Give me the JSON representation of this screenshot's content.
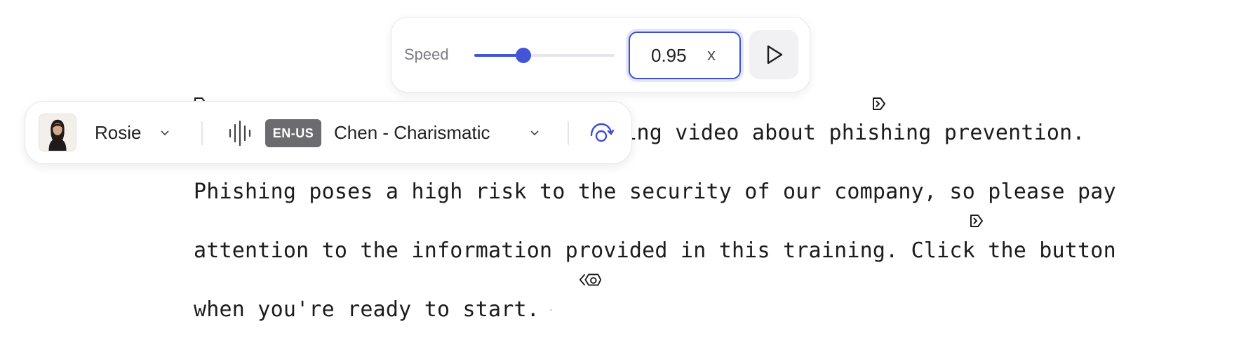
{
  "speed": {
    "label": "Speed",
    "value": "0.95",
    "unit": "x",
    "slider_fraction": 0.35,
    "accent_color": "#4155d6"
  },
  "voice_bar": {
    "avatar_name": "Rosie",
    "language_badge": "EN-US",
    "voice_name": "Chen - Charismatic",
    "icons": [
      "avatar-photo",
      "chevron-down-icon",
      "waveform-icon",
      "chevron-down-icon",
      "regenerate-icon"
    ]
  },
  "script": {
    "line1_visible": "ning video about phishing prevention.",
    "line2": "Phishing poses a high risk to the security of our company, so please pay",
    "line3": "attention to the information provided in this training. Click the button",
    "line4": "when you're ready to start."
  },
  "markers": [
    "pause-marker-icon",
    "pause-marker-icon",
    "pause-marker-icon",
    "rewind-marker-icon"
  ]
}
